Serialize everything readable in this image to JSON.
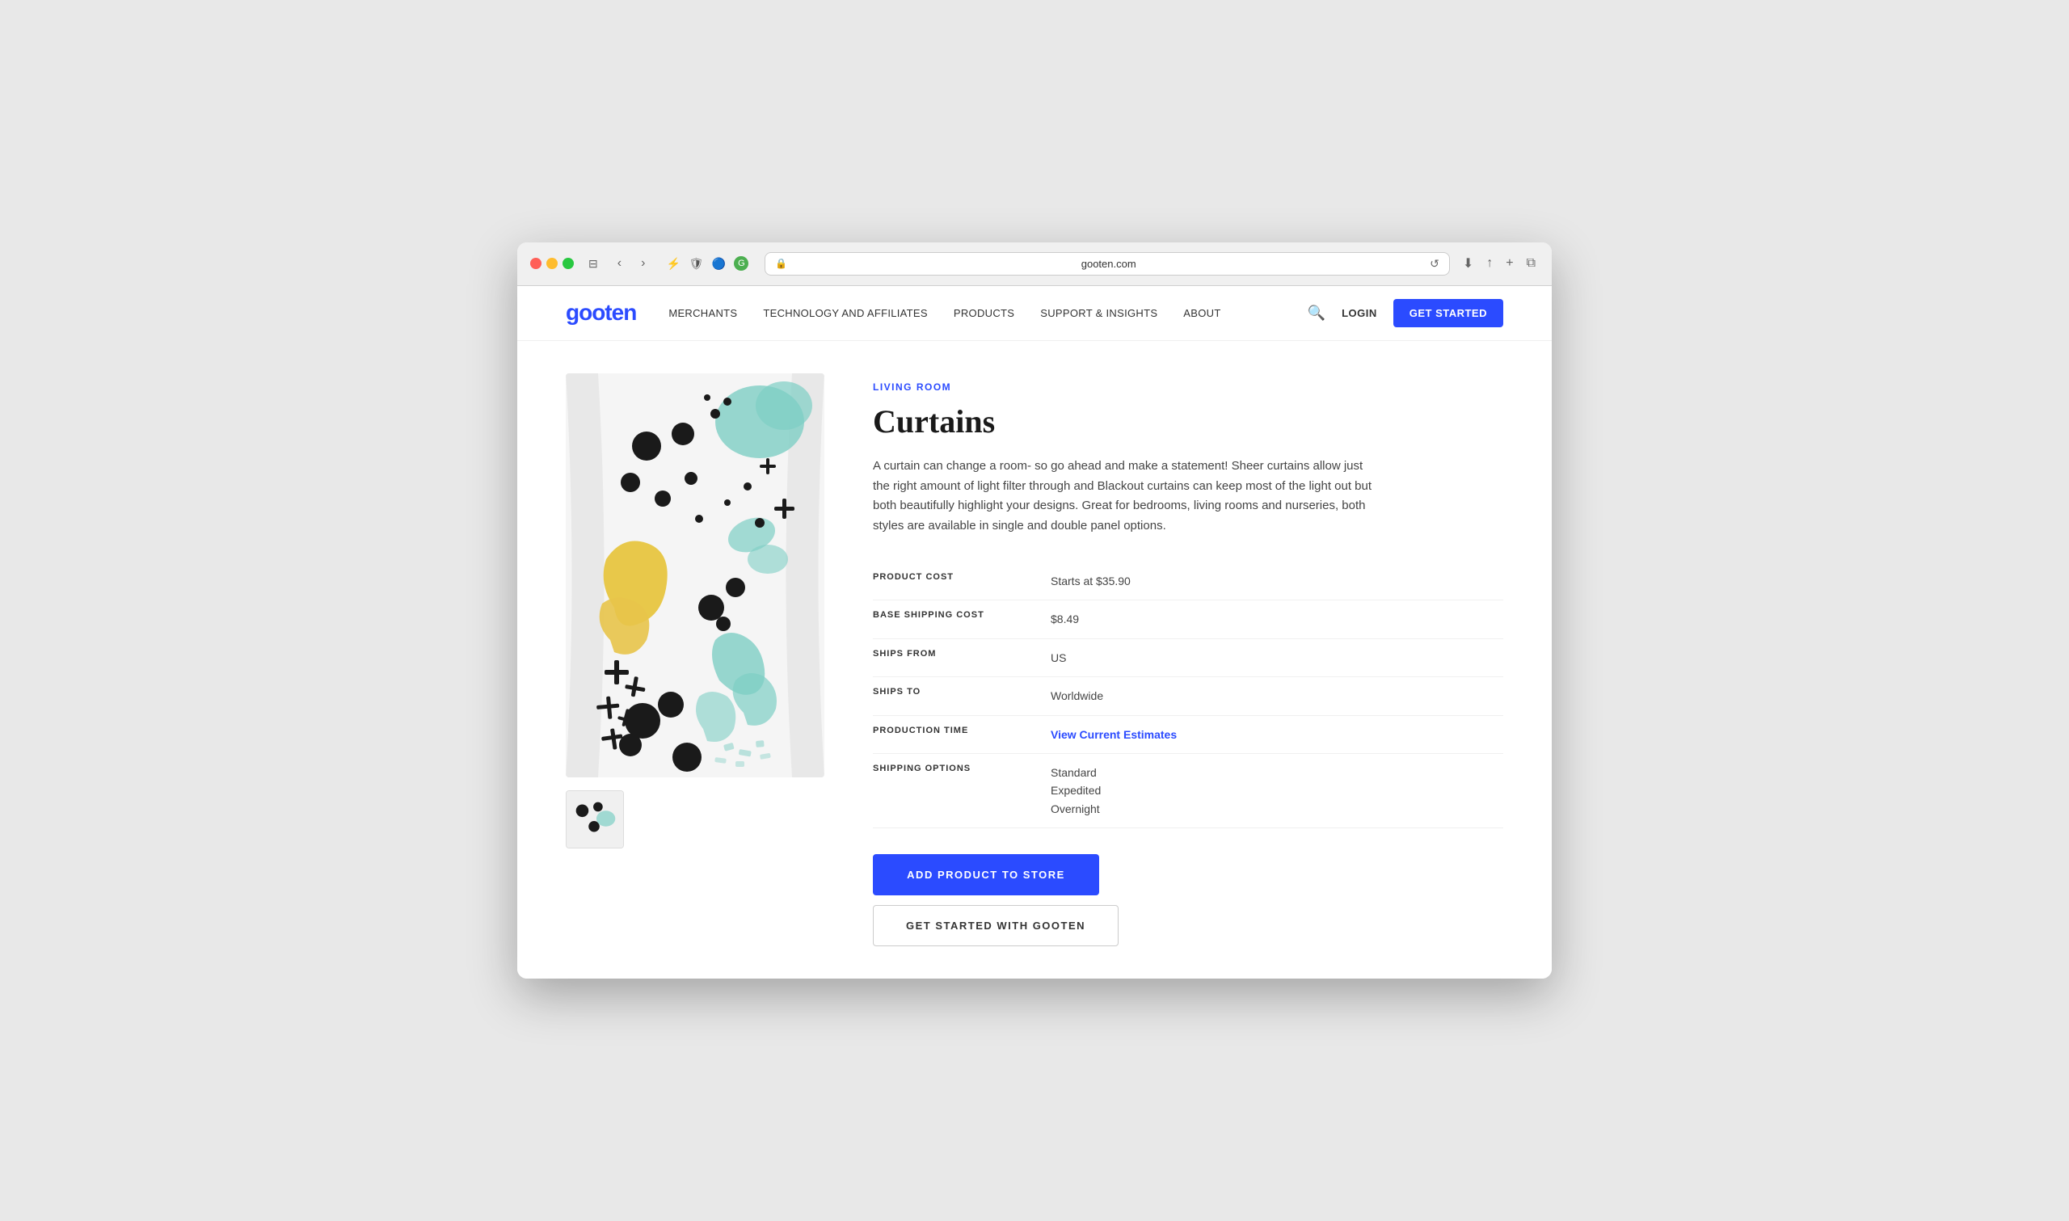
{
  "browser": {
    "url": "gooten.com",
    "lock_icon": "🔒",
    "reload_icon": "↺",
    "back_icon": "‹",
    "forward_icon": "›",
    "tab_icon": "⊞",
    "download_icon": "⬇",
    "share_icon": "↑",
    "new_tab_icon": "+",
    "tabs_icon": "⧉"
  },
  "toolbar_icons": [
    {
      "name": "sidebar-icon",
      "glyph": "⊟"
    },
    {
      "name": "shield-icon",
      "glyph": "🛡"
    },
    {
      "name": "bookmark-icon",
      "glyph": "🔖"
    },
    {
      "name": "extension-icon",
      "glyph": "🟢"
    }
  ],
  "nav": {
    "logo": "gooten",
    "links": [
      {
        "label": "MERCHANTS",
        "name": "nav-merchants"
      },
      {
        "label": "TECHNOLOGY AND AFFILIATES",
        "name": "nav-technology"
      },
      {
        "label": "PRODUCTS",
        "name": "nav-products"
      },
      {
        "label": "SUPPORT & INSIGHTS",
        "name": "nav-support"
      },
      {
        "label": "ABOUT",
        "name": "nav-about"
      }
    ],
    "login_label": "LOGIN",
    "get_started_label": "GET STARTED"
  },
  "product": {
    "category": "LIVING ROOM",
    "title": "Curtains",
    "description": "A curtain can change a room- so go ahead and make a statement! Sheer curtains allow just the right amount of light filter through and Blackout curtains can keep most of the light out but both beautifully highlight your designs. Great for bedrooms, living rooms and nurseries, both styles are available in single and double panel options.",
    "specs": [
      {
        "label": "PRODUCT COST",
        "value": "Starts at $35.90",
        "link": false
      },
      {
        "label": "BASE SHIPPING COST",
        "value": "$8.49",
        "link": false
      },
      {
        "label": "SHIPS FROM",
        "value": "US",
        "link": false
      },
      {
        "label": "SHIPS TO",
        "value": "Worldwide",
        "link": false
      },
      {
        "label": "PRODUCTION TIME",
        "value": "View Current Estimates",
        "link": true
      },
      {
        "label": "SHIPPING OPTIONS",
        "value": "Standard\nExpedited\nOvernight",
        "link": false
      }
    ],
    "add_button": "ADD PRODUCT TO STORE",
    "get_started_button": "GET STARTED WITH GOOTEN",
    "production_time_link": "View Current Estimates"
  }
}
